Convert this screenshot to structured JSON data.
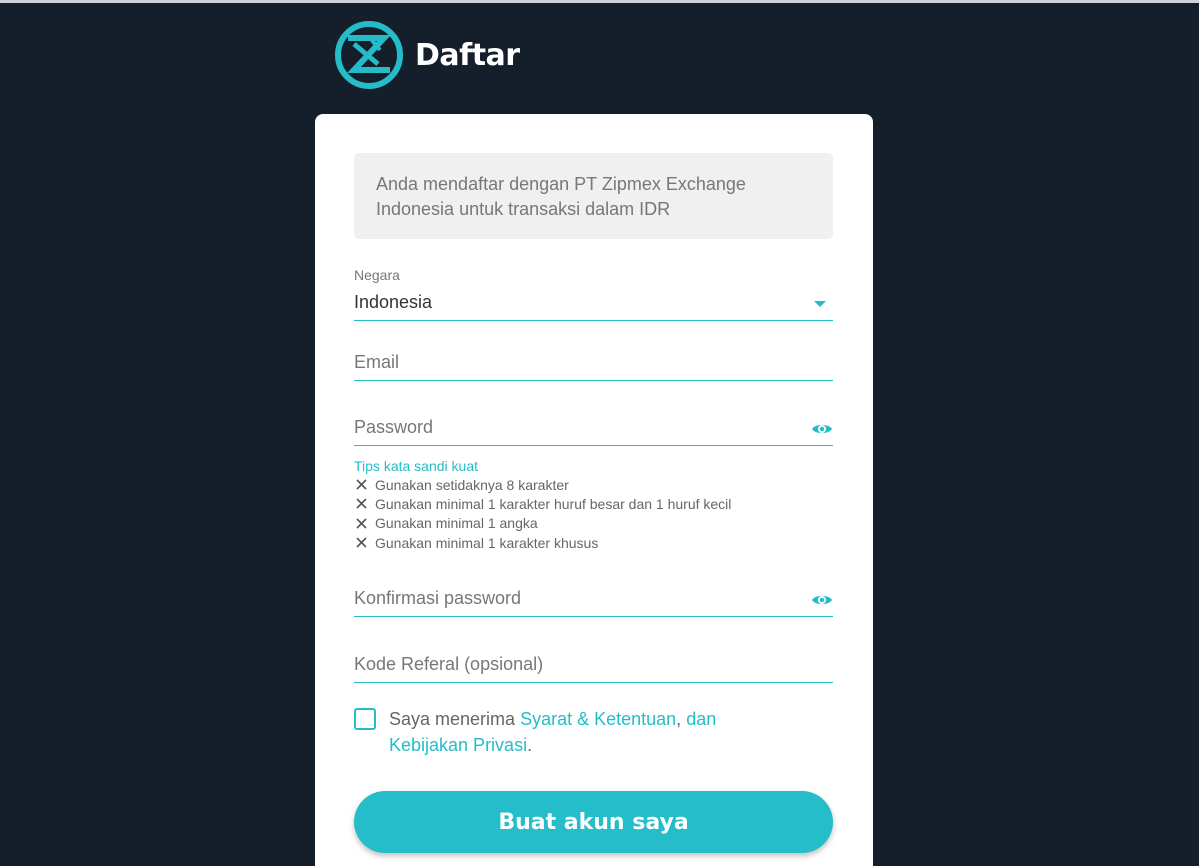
{
  "header": {
    "logo_icon": "zipmex-logo-icon",
    "title": "Daftar"
  },
  "notice": {
    "text": "Anda mendaftar dengan PT Zipmex Exchange Indonesia untuk transaksi dalam IDR"
  },
  "form": {
    "country": {
      "label": "Negara",
      "value": "Indonesia",
      "icon": "dropdown-arrow-icon"
    },
    "email": {
      "placeholder": "Email"
    },
    "password": {
      "placeholder": "Password",
      "icon": "eye-icon"
    },
    "password_tips": {
      "title": "Tips kata sandi kuat",
      "items": [
        "Gunakan setidaknya 8 karakter",
        "Gunakan minimal 1 karakter huruf besar dan 1 huruf kecil",
        "Gunakan minimal 1 angka",
        "Gunakan minimal 1 karakter khusus"
      ],
      "item_icon": "close-x-icon"
    },
    "confirm_password": {
      "placeholder": "Konfirmasi password",
      "icon": "eye-icon"
    },
    "referral": {
      "placeholder": "Kode Referal (opsional)"
    },
    "terms": {
      "checked": false,
      "prefix": "Saya menerima ",
      "terms_link": "Syarat & Ketentuan",
      "separator": ",",
      "and_text": " dan",
      "privacy_link": "Kebijakan Privasi",
      "suffix": "."
    },
    "submit_label": "Buat akun saya"
  },
  "colors": {
    "background": "#151f2c",
    "accent": "#24bdc9",
    "card": "#ffffff",
    "notice_bg": "#f0f0f0"
  }
}
